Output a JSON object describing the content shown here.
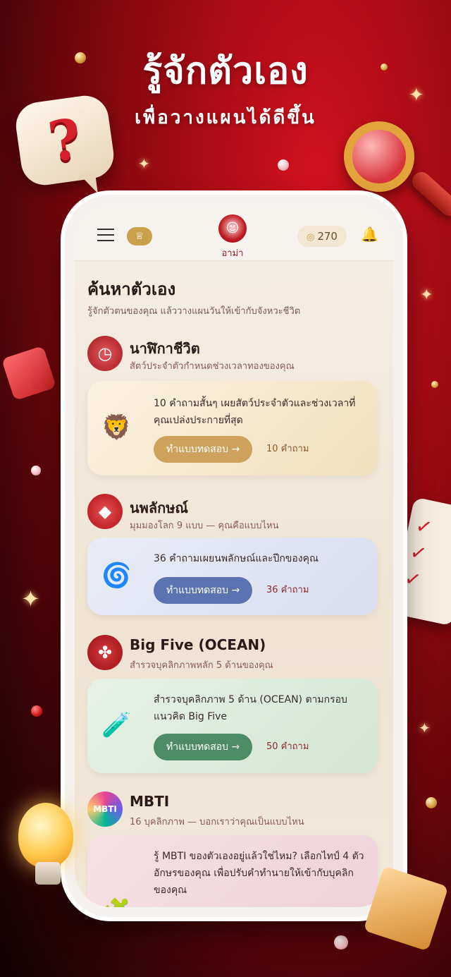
{
  "hero": {
    "title": "รู้จักตัวเอง",
    "subtitle": "เพื่อวางแผนได้ดีขึ้น"
  },
  "appbar": {
    "avatar_name": "อาม่า",
    "coins": "270",
    "icons": [
      "menu-icon",
      "badge-icon",
      "avatar",
      "coin-icon",
      "bell-icon"
    ]
  },
  "page": {
    "title": "ค้นหาตัวเอง",
    "subtitle": "รู้จักตัวตนของคุณ แล้ววางแผนวันให้เข้ากับจังหวะชีวิต"
  },
  "sections": [
    {
      "title": "นาฬิกาชีวิต",
      "subtitle": "สัตว์ประจำตัวกำหนดช่วงเวลาทองของคุณ",
      "card_text": "10 คำถามสั้นๆ เผยสัตว์ประจำตัวและช่วงเวลาที่คุณเปล่งประกายที่สุด",
      "button": "ทำแบบทดสอบ →",
      "count": "10 คำถาม",
      "icon": "clock-icon",
      "accent": "#c9a14a"
    },
    {
      "title": "นพลักษณ์",
      "subtitle": "มุมมองโลก 9 แบบ — คุณคือแบบไหน",
      "card_text": "36 คำถามเผยนพลักษณ์และปีกของคุณ",
      "button": "ทำแบบทดสอบ →",
      "count": "36 คำถาม",
      "icon": "gem-icon",
      "accent": "#5b73b0"
    },
    {
      "title": "Big Five (OCEAN)",
      "subtitle": "สำรวจบุคลิกภาพหลัก 5 ด้านของคุณ",
      "card_text": "สำรวจบุคลิกภาพ 5 ด้าน (OCEAN) ตามกรอบแนวคิด Big Five",
      "button": "ทำแบบทดสอบ →",
      "count": "50 คำถาม",
      "icon": "people-icon",
      "accent": "#4e8c66"
    },
    {
      "title": "MBTI",
      "subtitle": "16 บุคลิกภาพ — บอกเราว่าคุณเป็นแบบไหน",
      "card_text": "รู้ MBTI ของตัวเองอยู่แล้วใช่ไหม? เลือกไทป์ 4 ตัวอักษรของคุณ เพื่อปรับคำทำนายให้เข้ากับบุคลิกของคุณ",
      "icon_label": "MBTI",
      "icon": "mbti-icon"
    }
  ]
}
